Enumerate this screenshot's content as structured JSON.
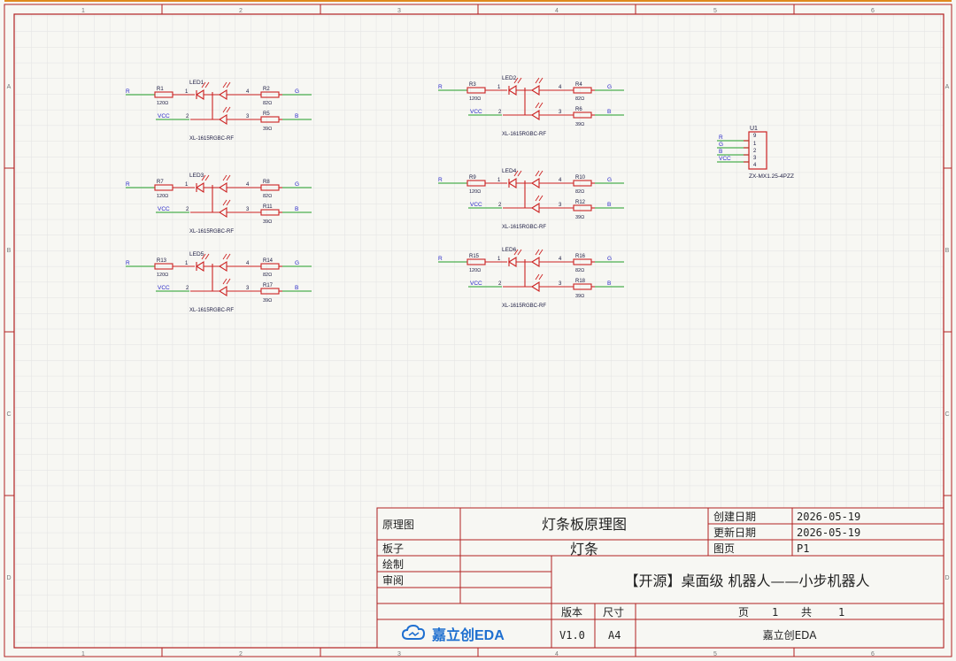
{
  "frame": {
    "col_labels": [
      "1",
      "2",
      "3",
      "4",
      "5",
      "6"
    ],
    "row_labels": [
      "A",
      "B",
      "C",
      "D"
    ]
  },
  "led_groups": [
    {
      "led": "LED1",
      "r_in": "R1",
      "r_in_val": "120Ω",
      "r_g": "R2",
      "r_g_val": "82Ω",
      "r_b": "R5",
      "r_b_val": "39Ω",
      "part": "XL-1615RGBC-RF"
    },
    {
      "led": "LED2",
      "r_in": "R3",
      "r_in_val": "120Ω",
      "r_g": "R4",
      "r_g_val": "82Ω",
      "r_b": "R6",
      "r_b_val": "39Ω",
      "part": "XL-1615RGBC-RF"
    },
    {
      "led": "LED3",
      "r_in": "R7",
      "r_in_val": "120Ω",
      "r_g": "R8",
      "r_g_val": "82Ω",
      "r_b": "R11",
      "r_b_val": "39Ω",
      "part": "XL-1615RGBC-RF"
    },
    {
      "led": "LED4",
      "r_in": "R9",
      "r_in_val": "120Ω",
      "r_g": "R10",
      "r_g_val": "82Ω",
      "r_b": "R12",
      "r_b_val": "39Ω",
      "part": "XL-1615RGBC-RF"
    },
    {
      "led": "LED5",
      "r_in": "R13",
      "r_in_val": "120Ω",
      "r_g": "R14",
      "r_g_val": "82Ω",
      "r_b": "R17",
      "r_b_val": "39Ω",
      "part": "XL-1615RGBC-RF"
    },
    {
      "led": "LED6",
      "r_in": "R15",
      "r_in_val": "120Ω",
      "r_g": "R16",
      "r_g_val": "82Ω",
      "r_b": "R18",
      "r_b_val": "39Ω",
      "part": "XL-1615RGBC-RF"
    }
  ],
  "nets": {
    "r": "R",
    "g": "G",
    "b": "B",
    "vcc": "VCC"
  },
  "pins": {
    "p1": "1",
    "p2": "2",
    "p3": "3",
    "p4": "4"
  },
  "connector": {
    "ref": "U1",
    "part": "ZX-MX1.25-4PZZ",
    "nets": [
      "R",
      "G",
      "B",
      "VCC"
    ],
    "pins": [
      "9",
      "1",
      "2",
      "3",
      "4"
    ]
  },
  "title_block": {
    "schematic_label": "原理图",
    "schematic_value": "灯条板原理图",
    "board_label": "板子",
    "board_value": "灯条",
    "drawn_label": "绘制",
    "review_label": "审阅",
    "created_label": "创建日期",
    "created_value": "2026-05-19",
    "updated_label": "更新日期",
    "updated_value": "2026-05-19",
    "page_label": "图页",
    "page_value": "P1",
    "project_title": "【开源】桌面级 机器人——小步机器人",
    "version_label": "版本",
    "size_label": "尺寸",
    "page_word": "页",
    "page_num": "1",
    "total_word": "共",
    "total_num": "1",
    "version_value": "V1.0",
    "size_value": "A4",
    "company": "嘉立创EDA",
    "logo_text": "嘉立创EDA"
  },
  "colors": {
    "frame": "#b22222",
    "grid": "#e2e2e2",
    "component": "#cc2222",
    "wire": "#4caf50",
    "net_label": "#2a2ac8",
    "text_dark": "#1a1a40",
    "logo": "#1e6fd0",
    "background": "#f7f7f3"
  },
  "icons": {
    "logo": "cloud-logo-icon",
    "led": "led-diode-icon",
    "resistor": "resistor-icon"
  }
}
